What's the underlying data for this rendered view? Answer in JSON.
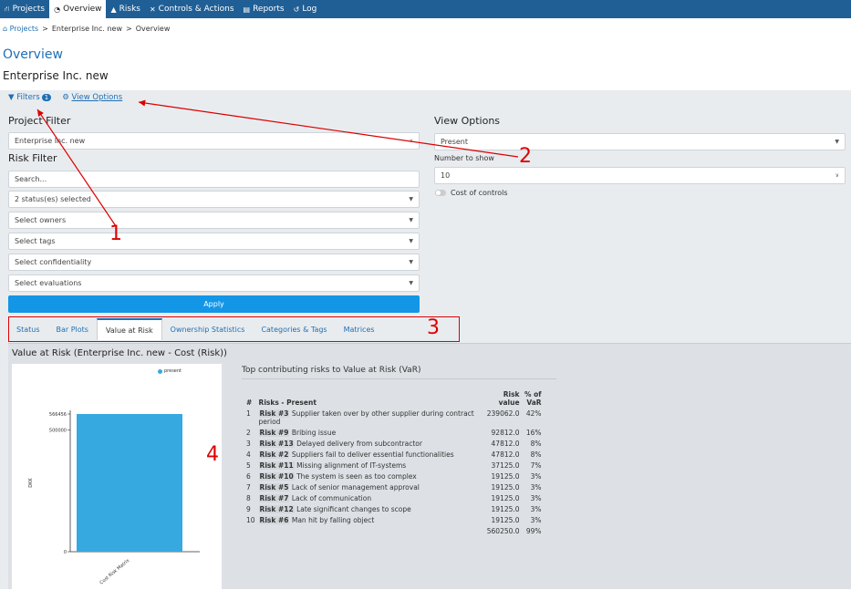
{
  "nav": {
    "items": [
      {
        "label": "Projects",
        "icon": "sitemap-icon"
      },
      {
        "label": "Overview",
        "icon": "dashboard-icon",
        "active": true
      },
      {
        "label": "Risks",
        "icon": "warning-icon"
      },
      {
        "label": "Controls & Actions",
        "icon": "tools-icon"
      },
      {
        "label": "Reports",
        "icon": "document-icon"
      },
      {
        "label": "Log",
        "icon": "history-icon"
      }
    ]
  },
  "breadcrumb": {
    "home": "Projects",
    "sep1": ">",
    "project": "Enterprise Inc. new",
    "sep2": ">",
    "current": "Overview"
  },
  "page": {
    "title": "Overview",
    "project": "Enterprise Inc. new"
  },
  "controls": {
    "filters_label": "Filters",
    "filters_count": "1",
    "view_options_label": "View Options"
  },
  "project_filter": {
    "heading": "Project Filter",
    "value": "Enterprise Inc. new"
  },
  "risk_filter": {
    "heading": "Risk Filter",
    "search_placeholder": "Search...",
    "status": "2 status(es) selected",
    "owners": "Select owners",
    "tags": "Select tags",
    "confidentiality": "Select confidentiality",
    "evaluations": "Select evaluations",
    "apply": "Apply"
  },
  "view_options": {
    "heading": "View Options",
    "mode": "Present",
    "number_label": "Number to show",
    "number_value": "10",
    "cost_label": "Cost of controls"
  },
  "tabs": [
    {
      "label": "Status"
    },
    {
      "label": "Bar Plots"
    },
    {
      "label": "Value at Risk",
      "active": true
    },
    {
      "label": "Ownership Statistics"
    },
    {
      "label": "Categories & Tags"
    },
    {
      "label": "Matrices"
    }
  ],
  "var": {
    "title": "Value at Risk (Enterprise Inc. new - Cost (Risk))",
    "table_title": "Top contributing risks to Value at Risk (VaR)",
    "col_num": "#",
    "col_risks": "Risks - Present",
    "col_value": "Risk value",
    "col_pct": "% of VaR",
    "rows": [
      {
        "n": "1",
        "id": "Risk #3",
        "desc": "Supplier taken over by other supplier during contract period",
        "value": "239062.0",
        "pct": "42%"
      },
      {
        "n": "2",
        "id": "Risk #9",
        "desc": "Bribing issue",
        "value": "92812.0",
        "pct": "16%"
      },
      {
        "n": "3",
        "id": "Risk #13",
        "desc": "Delayed delivery from subcontractor",
        "value": "47812.0",
        "pct": "8%"
      },
      {
        "n": "4",
        "id": "Risk #2",
        "desc": "Suppliers fail to deliver essential functionalities",
        "value": "47812.0",
        "pct": "8%"
      },
      {
        "n": "5",
        "id": "Risk #11",
        "desc": "Missing alignment of IT-systems",
        "value": "37125.0",
        "pct": "7%"
      },
      {
        "n": "6",
        "id": "Risk #10",
        "desc": "The system is seen as too complex",
        "value": "19125.0",
        "pct": "3%"
      },
      {
        "n": "7",
        "id": "Risk #5",
        "desc": "Lack of senior management approval",
        "value": "19125.0",
        "pct": "3%"
      },
      {
        "n": "8",
        "id": "Risk #7",
        "desc": "Lack of communication",
        "value": "19125.0",
        "pct": "3%"
      },
      {
        "n": "9",
        "id": "Risk #12",
        "desc": "Late significant changes to scope",
        "value": "19125.0",
        "pct": "3%"
      },
      {
        "n": "10",
        "id": "Risk #6",
        "desc": "Man hit by falling object",
        "value": "19125.0",
        "pct": "3%"
      }
    ],
    "total_value": "560250.0",
    "total_pct": "99%"
  },
  "chart_data": {
    "type": "bar",
    "categories": [
      "Cost Risk Matrix"
    ],
    "series": [
      {
        "name": "present",
        "values": [
          566456
        ]
      }
    ],
    "ylabel": "DKK",
    "yticks": [
      "0",
      "500000",
      "566456"
    ],
    "ylim": [
      0,
      566456
    ],
    "legend": "top",
    "colors": {
      "present": "#36a9e1"
    }
  },
  "annotations": {
    "a1": "1",
    "a2": "2",
    "a3": "3",
    "a4": "4",
    "color": "#dd0000"
  }
}
